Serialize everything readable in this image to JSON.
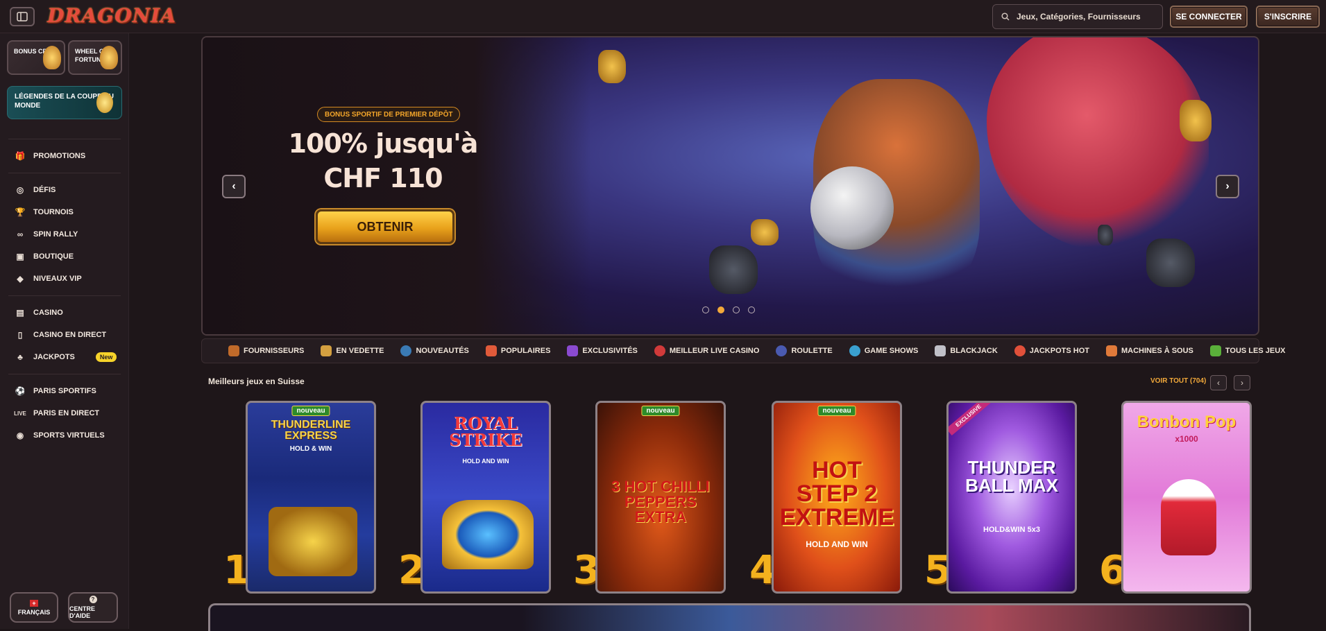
{
  "header": {
    "logo": "DRAGONIA",
    "search_placeholder": "Jeux, Catégories, Fournisseurs",
    "login_label": "SE CONNECTER",
    "register_label": "S'INSCRIRE"
  },
  "sidebar": {
    "tiles": [
      {
        "label": "BONUS CRAB"
      },
      {
        "label": "WHEEL OF FORTUNE"
      }
    ],
    "legends": "LÉGENDES DE LA COUPE DU MONDE",
    "group1": [
      {
        "label": "PROMOTIONS",
        "icon": "gift-icon"
      }
    ],
    "group2": [
      {
        "label": "DÉFIS",
        "icon": "medal-icon"
      },
      {
        "label": "TOURNOIS",
        "icon": "trophy-icon"
      },
      {
        "label": "SPIN RALLY",
        "icon": "rally-icon"
      },
      {
        "label": "BOUTIQUE",
        "icon": "shop-icon"
      },
      {
        "label": "NIVEAUX VIP",
        "icon": "diamond-icon"
      }
    ],
    "group3": [
      {
        "label": "CASINO",
        "icon": "slot-icon"
      },
      {
        "label": "CASINO EN DIRECT",
        "icon": "live-casino-icon"
      },
      {
        "label": "JACKPOTS",
        "icon": "clover-icon",
        "badge": "New"
      }
    ],
    "group4": [
      {
        "label": "PARIS SPORTIFS",
        "icon": "ball-icon"
      },
      {
        "label": "PARIS EN DIRECT",
        "icon": "live-icon"
      },
      {
        "label": "SPORTS VIRTUELS",
        "icon": "virtual-sports-icon"
      }
    ],
    "language_label": "FRANÇAIS",
    "help_label": "CENTRE D'AIDE"
  },
  "hero": {
    "badge": "BONUS SPORTIF DE PREMIER DÉPÔT",
    "title": "100% jusqu'à CHF 110",
    "cta": "OBTENIR",
    "slides_total": 4,
    "active_slide": 2
  },
  "categories": [
    {
      "label": "FOURNISSEURS",
      "color": "#c06a2a"
    },
    {
      "label": "EN VEDETTE",
      "color": "#d4a040"
    },
    {
      "label": "NOUVEAUTÉS",
      "color": "#3a7ab4"
    },
    {
      "label": "POPULAIRES",
      "color": "#e05a3a"
    },
    {
      "label": "EXCLUSIVITÉS",
      "color": "#8a4ad0"
    },
    {
      "label": "MEILLEUR LIVE CASINO",
      "color": "#d03a3a"
    },
    {
      "label": "ROULETTE",
      "color": "#4a5ab0"
    },
    {
      "label": "GAME SHOWS",
      "color": "#3aa0d0"
    },
    {
      "label": "BLACKJACK",
      "color": "#c0c0c8"
    },
    {
      "label": "JACKPOTS HOT",
      "color": "#e0503a"
    },
    {
      "label": "MACHINES À SOUS",
      "color": "#e07a3a"
    },
    {
      "label": "TOUS LES JEUX",
      "color": "#5ab03a"
    }
  ],
  "games_section": {
    "title": "Meilleurs jeux en Suisse",
    "view_all": "VOIR TOUT (704)",
    "games": [
      {
        "rank": "1",
        "tag": "nouveau",
        "title": "THUNDERLINE EXPRESS",
        "sub": "HOLD & WIN"
      },
      {
        "rank": "2",
        "tag": "",
        "title": "ROYAL STRIKE",
        "sub": "HOLD AND WIN"
      },
      {
        "rank": "3",
        "tag": "nouveau",
        "title": "3 HOT CHILLI PEPPERS EXTRA",
        "sub": ""
      },
      {
        "rank": "4",
        "tag": "nouveau",
        "title": "HOT STEP 2 EXTREME",
        "sub": "HOLD AND WIN"
      },
      {
        "rank": "5",
        "tag": "EXCLUSIVE",
        "title": "THUNDER BALL MAX",
        "sub": "HOLD&WIN 5x3"
      },
      {
        "rank": "6",
        "tag": "",
        "title": "Bonbon Pop",
        "sub": "x1000"
      }
    ]
  }
}
